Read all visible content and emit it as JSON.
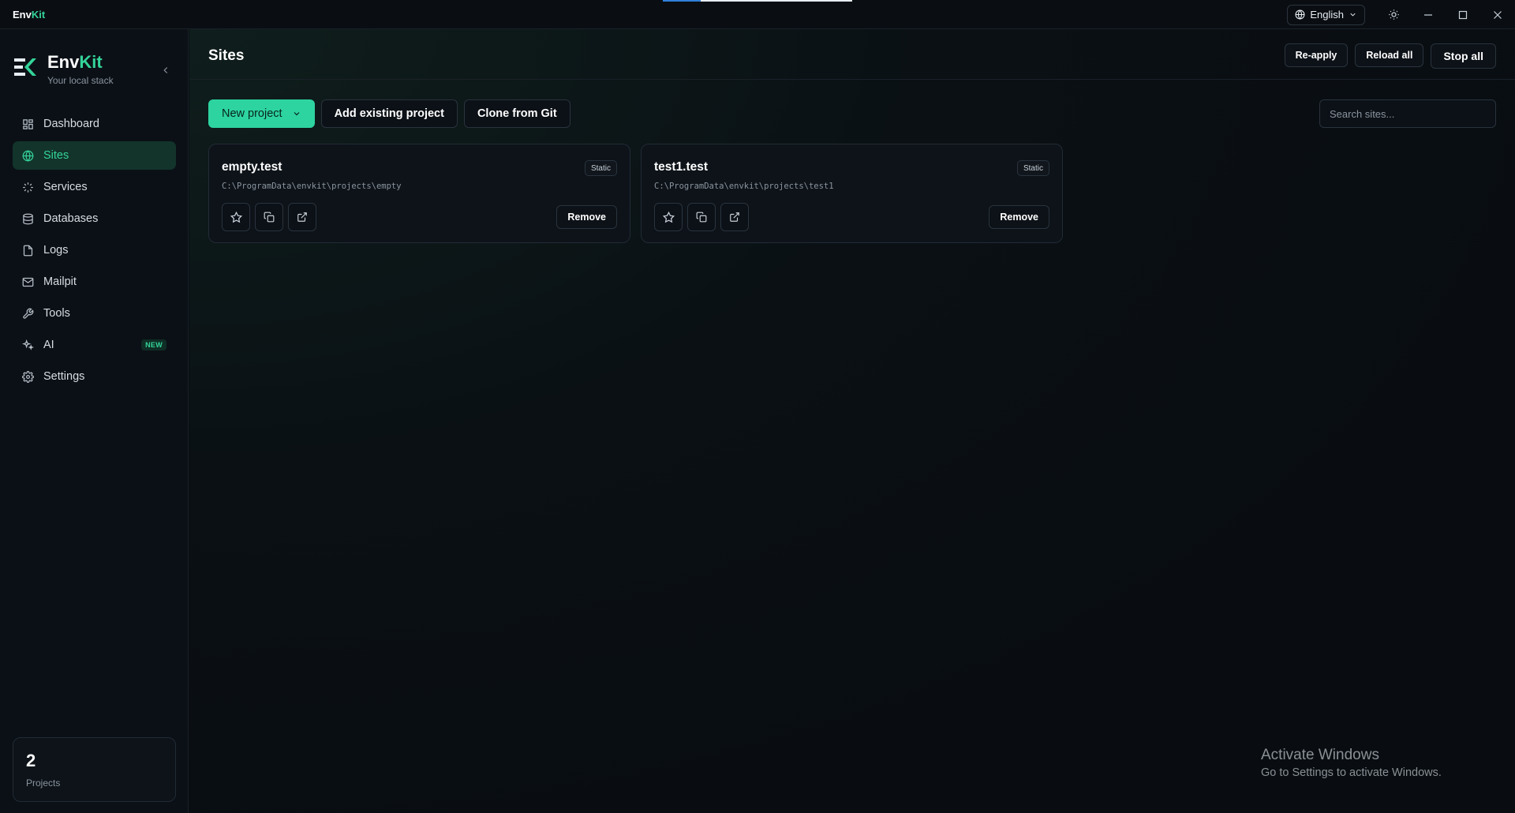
{
  "titlebar": {
    "brand_env": "Env",
    "brand_kit": "Kit",
    "language": "English"
  },
  "sidebar": {
    "logo_env": "Env",
    "logo_kit": "Kit",
    "tagline": "Your local stack",
    "items": [
      {
        "label": "Dashboard",
        "icon": "dashboard-icon"
      },
      {
        "label": "Sites",
        "icon": "globe-icon",
        "active": true
      },
      {
        "label": "Services",
        "icon": "loader-icon"
      },
      {
        "label": "Databases",
        "icon": "database-icon"
      },
      {
        "label": "Logs",
        "icon": "file-icon"
      },
      {
        "label": "Mailpit",
        "icon": "mail-icon"
      },
      {
        "label": "Tools",
        "icon": "wrench-icon"
      },
      {
        "label": "AI",
        "icon": "sparkles-icon",
        "badge": "NEW"
      },
      {
        "label": "Settings",
        "icon": "gear-icon"
      }
    ],
    "projects": {
      "count": "2",
      "label": "Projects"
    }
  },
  "header": {
    "title": "Sites",
    "actions": {
      "reapply": "Re-apply",
      "reload_all": "Reload all",
      "stop_all": "Stop all"
    }
  },
  "toolbar": {
    "new_project": "New project",
    "add_existing": "Add existing project",
    "clone_git": "Clone from Git",
    "search_placeholder": "Search sites..."
  },
  "sites": [
    {
      "name": "empty.test",
      "type": "Static",
      "path": "C:\\ProgramData\\envkit\\projects\\empty",
      "remove": "Remove"
    },
    {
      "name": "test1.test",
      "type": "Static",
      "path": "C:\\ProgramData\\envkit\\projects\\test1",
      "remove": "Remove"
    }
  ],
  "watermark": {
    "title": "Activate Windows",
    "subtitle": "Go to Settings to activate Windows."
  },
  "colors": {
    "accent": "#2dd4a0",
    "background": "#090d12",
    "active_nav_bg": "#12342b"
  }
}
